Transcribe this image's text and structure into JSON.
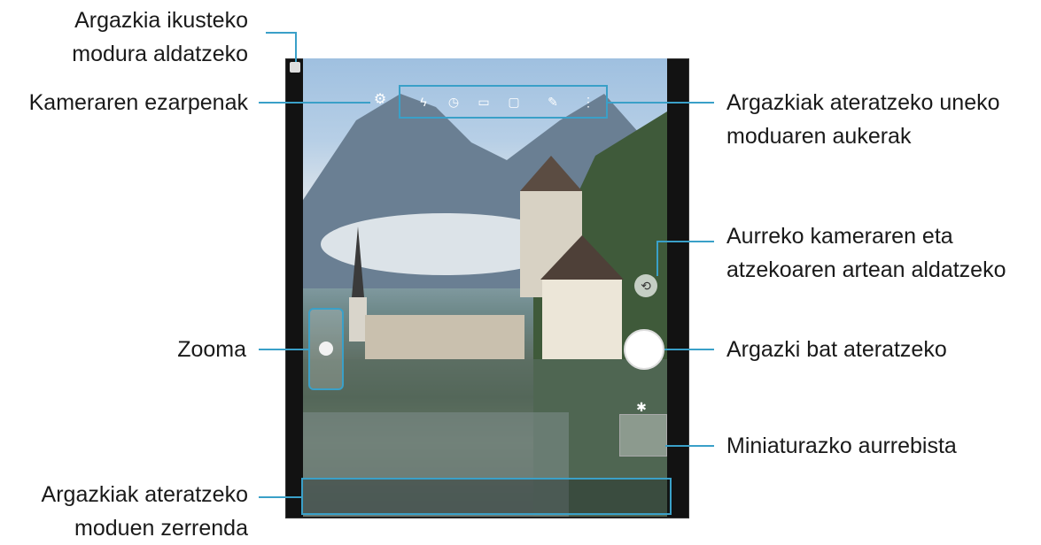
{
  "labels": {
    "gallery_mode": [
      "Argazkia ikusteko",
      "modura aldatzeko"
    ],
    "camera_settings": "Kameraren ezarpenak",
    "current_mode_options": [
      "Argazkiak ateratzeko uneko",
      "moduaren aukerak"
    ],
    "switch_camera": [
      "Aurreko kameraren eta",
      "atzekoaren artean aldatzeko"
    ],
    "zoom": "Zooma",
    "take_picture": "Argazki bat ateratzeko",
    "thumbnail_preview": "Miniaturazko aurrebista",
    "shooting_modes_list": [
      "Argazkiak ateratzeko",
      "moduen zerrenda"
    ]
  },
  "icons": {
    "settings": "gear-icon",
    "flash": "flash-icon",
    "timer": "timer-icon",
    "aspect_ratio": "aspect-ratio-icon",
    "motion_photo": "motion-photo-icon",
    "filters": "filter-icon",
    "more": "more-icon",
    "switch_camera": "switch-camera-icon",
    "thumbnail_badge": "star-icon"
  },
  "colors": {
    "callout_line": "#3aa0c8",
    "label_text": "#1a1a1a"
  }
}
